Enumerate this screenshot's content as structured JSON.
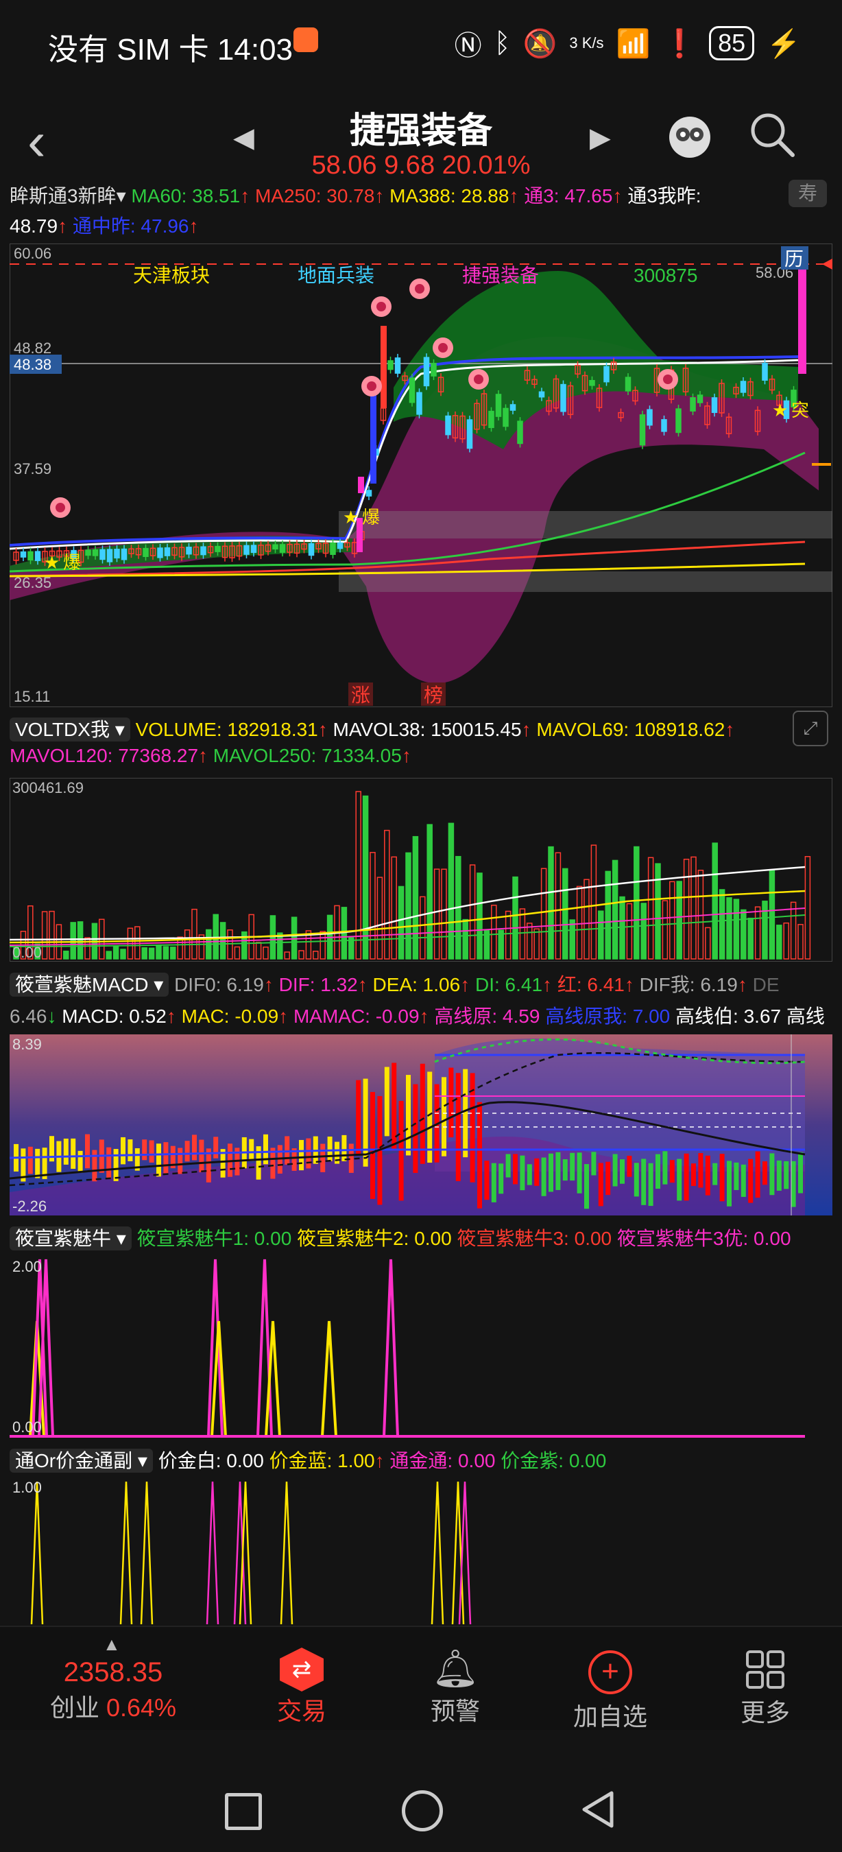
{
  "status": {
    "carrier_time": "没有 SIM 卡 14:03",
    "net_speed": "3 K/s",
    "battery": "85"
  },
  "header": {
    "title": "捷强装备",
    "subtitle": "58.06 9.68 20.01%"
  },
  "main_chart": {
    "ma_line1": [
      "眸斯通3新眸",
      "MA60: 38.51",
      "MA250: 30.78",
      "MA388: 28.88",
      "通3: 47.65",
      "通3我昨:"
    ],
    "ma_line2": [
      "48.79",
      "通中昨: 47.96"
    ],
    "prices": {
      "top": "60.06",
      "p1": "48.82",
      "p_current": "48.38",
      "p2": "37.59",
      "p3": "26.35",
      "bottom": "15.11",
      "last": "58.06"
    },
    "tags": [
      "天津板块",
      "地面兵装",
      "捷强装备",
      "300875"
    ],
    "marks": {
      "li": "历",
      "bao1": "爆",
      "bao2": "爆",
      "tu": "突",
      "zhang": "涨",
      "bang": "榜"
    }
  },
  "volume_panel": {
    "label": "VOLTDX我",
    "line1": [
      "VOLUME: 182918.31",
      "MAVOL38: 150015.45",
      "MAVOL69: 108918.62"
    ],
    "line2": [
      "MAVOL120: 77368.27",
      "MAVOL250: 71334.05"
    ],
    "max": "300461.69",
    "min": "0.00"
  },
  "macd_panel": {
    "label": "筱萱紫魅MACD",
    "line1": [
      "DIF0: 6.19",
      "DIF: 1.32",
      "DEA: 1.06",
      "DI: 6.41",
      "红: 6.41",
      "DIF我: 6.19",
      "DE"
    ],
    "line2": [
      "6.46",
      "MACD: 0.52",
      "MAC: -0.09",
      "MAMAC: -0.09",
      "高线原: 4.59",
      "高线原我: 7.00",
      "高线伯: 3.67",
      "高线"
    ],
    "max": "8.39",
    "min": "-2.26"
  },
  "bull_panel": {
    "label": "筱宣紫魅牛",
    "items": [
      "筱宣紫魅牛1: 0.00",
      "筱宣紫魅牛2: 0.00",
      "筱宣紫魅牛3: 0.00",
      "筱宣紫魅牛3优: 0.00"
    ],
    "max": "2.00",
    "min": "0.00"
  },
  "gold_panel": {
    "label": "通Or价金通副",
    "items": [
      "价金白: 0.00",
      "价金蓝: 1.00",
      "通金通: 0.00",
      "价金紫: 0.00"
    ],
    "max": "1.00"
  },
  "bottom_nav": {
    "index_value": "2358.35",
    "index_name": "创业",
    "index_change": "0.64%",
    "trade": "交易",
    "alert": "预警",
    "add": "加自选",
    "more": "更多"
  },
  "colors": {
    "red": "#ff3b30",
    "green": "#2ecc40",
    "yellow": "#ffe600",
    "magenta": "#ff2fc8",
    "blue": "#2f3fff"
  }
}
